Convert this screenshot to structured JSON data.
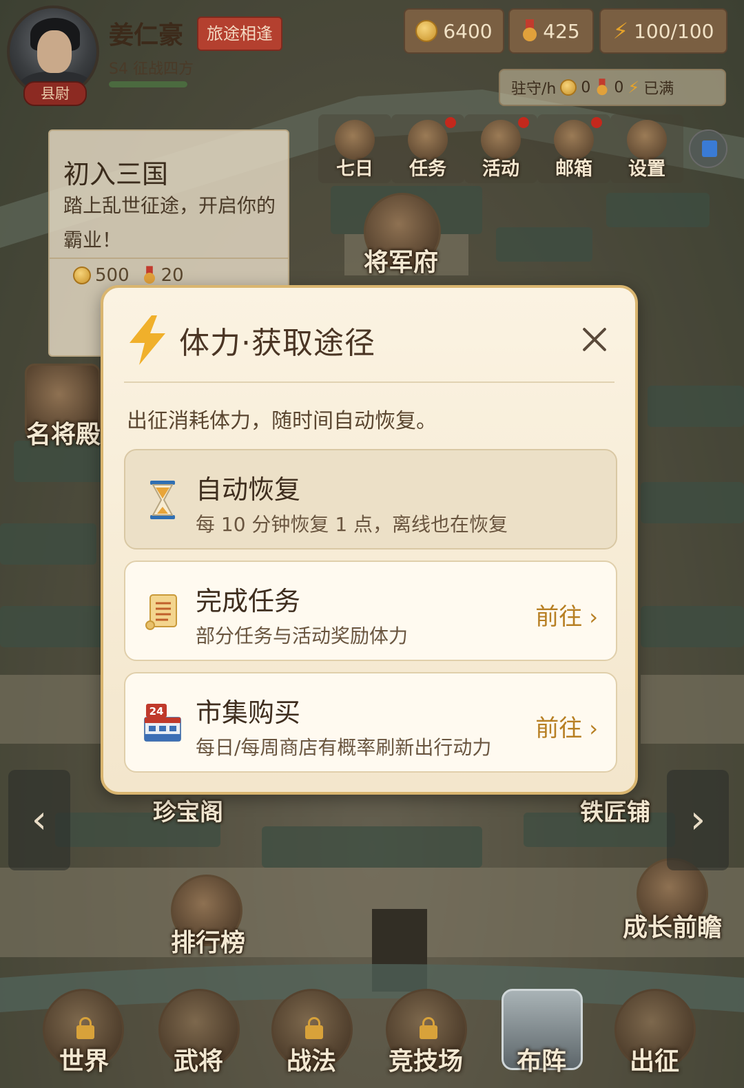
{
  "player": {
    "name": "姜仁豪",
    "title_badge": "旅途相逢",
    "season": "S4 征战四方",
    "rank": "县尉",
    "exp_progress": 1.0
  },
  "resources": {
    "gold": "6400",
    "honor": "425",
    "stamina": "100/100"
  },
  "garrison": {
    "label": "驻守/h",
    "gold": "0",
    "honor": "0",
    "stamina_status": "已满"
  },
  "menu": [
    {
      "label": "七日",
      "icon": "treasure-chest-icon",
      "badge": false
    },
    {
      "label": "任务",
      "icon": "scroll-icon",
      "badge": true
    },
    {
      "label": "活动",
      "icon": "event-shield-icon",
      "badge": true
    },
    {
      "label": "邮箱",
      "icon": "mail-scroll-icon",
      "badge": true
    },
    {
      "label": "设置",
      "icon": "settings-gear-icon",
      "badge": false
    }
  ],
  "quest": {
    "title": "初入三国",
    "description": "踏上乱世征途，开启你的霸业！",
    "reward_gold": "500",
    "reward_honor": "20"
  },
  "buildings": {
    "general_mansion": "将军府",
    "hall_of_fame": "名将殿",
    "treasure_pavilion": "珍宝阁",
    "blacksmith": "铁匠铺",
    "leaderboard": "排行榜",
    "growth_preview": "成长前瞻"
  },
  "bottom_nav": [
    {
      "label": "世界",
      "locked": true
    },
    {
      "label": "武将",
      "locked": false
    },
    {
      "label": "战法",
      "locked": true
    },
    {
      "label": "竞技场",
      "locked": true
    },
    {
      "label": "布阵",
      "locked": false,
      "active": true
    },
    {
      "label": "出征",
      "locked": false
    }
  ],
  "modal": {
    "title": "体力·获取途径",
    "description": "出征消耗体力，随时间自动恢复。",
    "options": [
      {
        "title": "自动恢复",
        "subtitle": "每 10 分钟恢复 1 点，离线也在恢复",
        "icon": "hourglass-icon",
        "action": ""
      },
      {
        "title": "完成任务",
        "subtitle": "部分任务与活动奖励体力",
        "icon": "scroll-icon",
        "action": "前往"
      },
      {
        "title": "市集购买",
        "subtitle": "每日/每周商店有概率刷新出行动力",
        "icon": "shop-24-icon",
        "action": "前往"
      }
    ]
  },
  "colors": {
    "modal_bg": "#fbf3e2",
    "accent_gold": "#b77f23",
    "bolt": "#e6a32a",
    "badge_red": "#c4281c"
  }
}
